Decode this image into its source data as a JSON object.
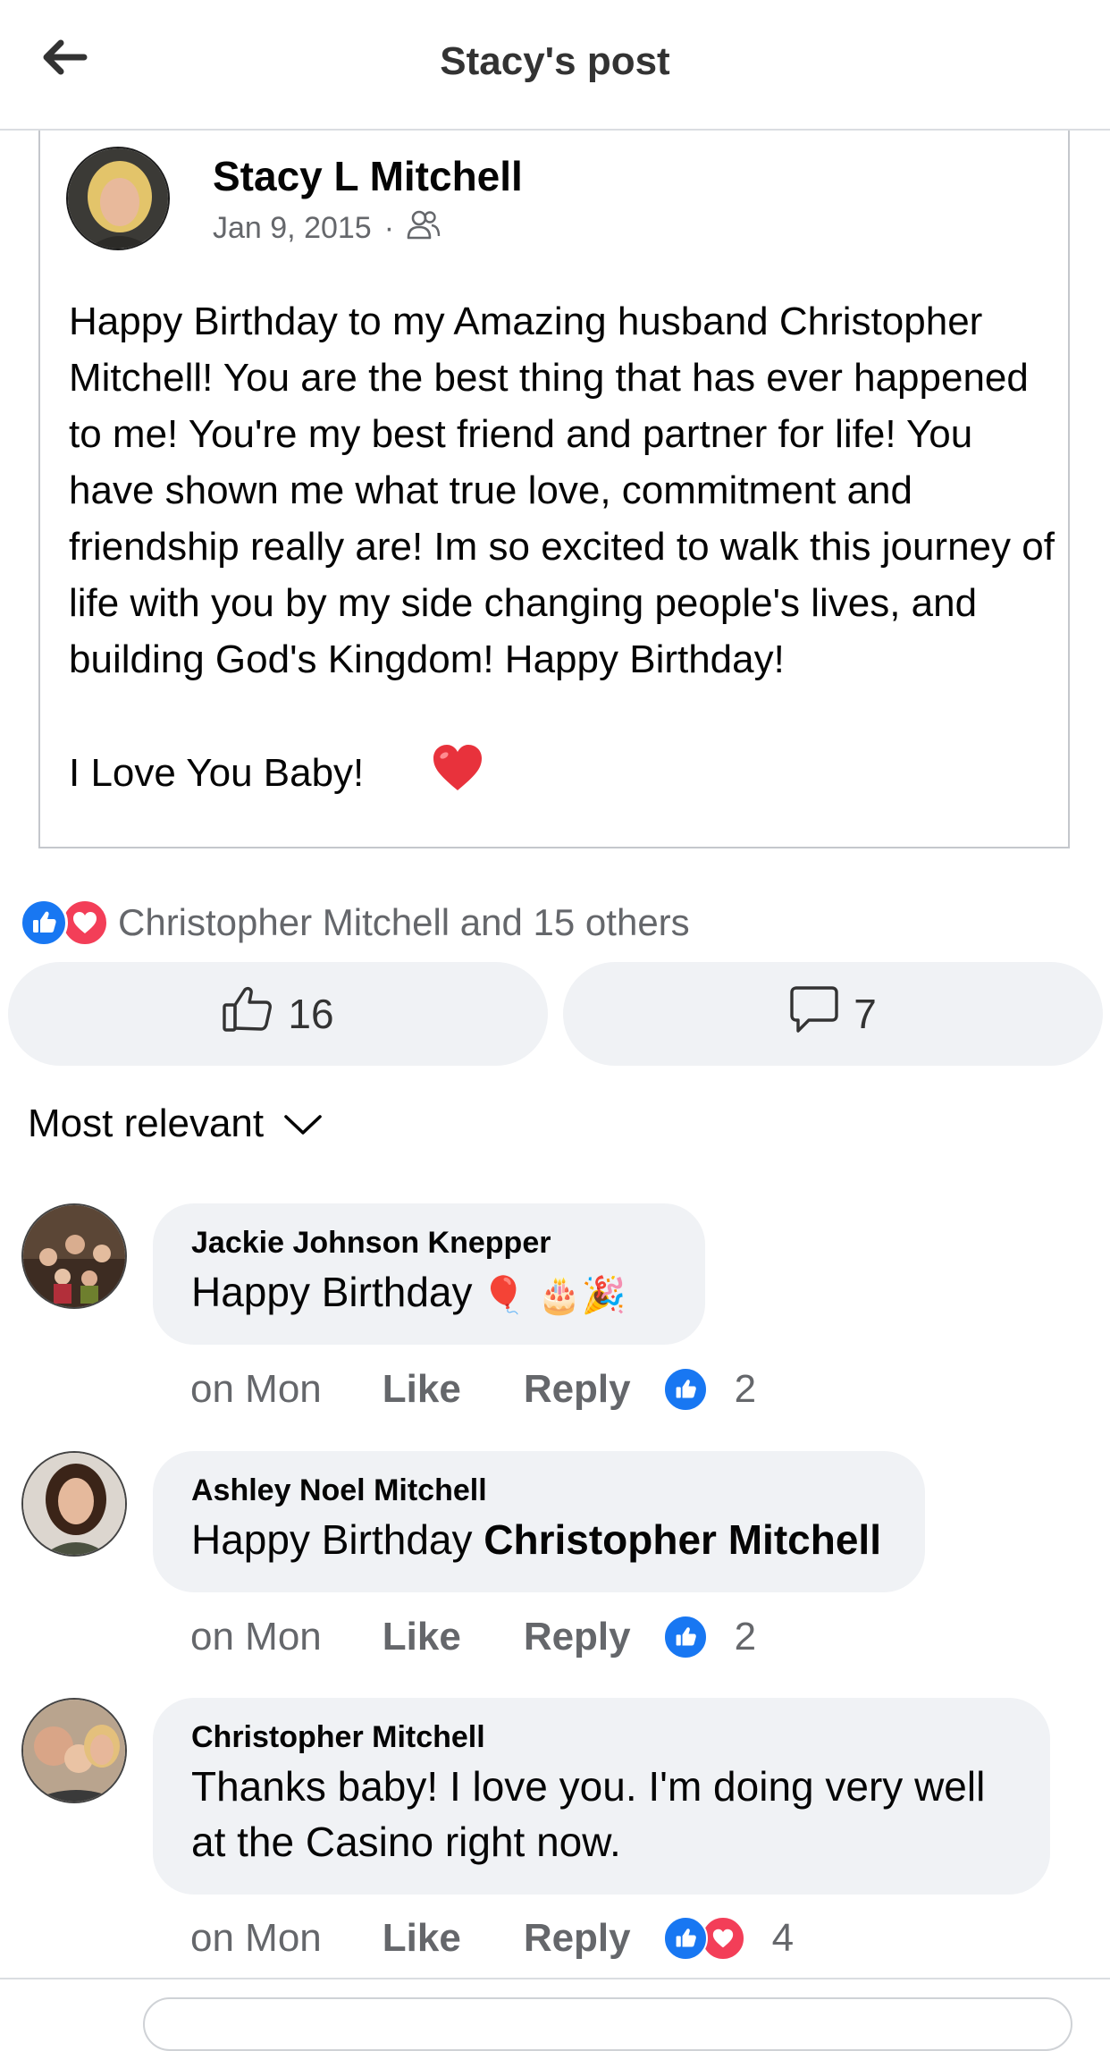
{
  "header": {
    "title": "Stacy's post",
    "back_icon": "arrow-left-icon"
  },
  "post": {
    "author": "Stacy L Mitchell",
    "date": "Jan 9, 2015",
    "separator": "·",
    "audience_icon": "friends-icon",
    "text": "Happy Birthday to my Amazing husband Christopher Mitchell! You are the best thing that has ever happened to me! You're my best friend and partner for life! You have shown me what true love, commitment and friendship really are! Im so excited to walk this journey of life with you by my side changing people's lives, and building God's Kingdom! Happy Birthday!\nI Love You Baby!",
    "trailing_emoji": "❤️"
  },
  "reactions": {
    "summary": "Christopher Mitchell and 15 others",
    "icons": [
      "like-reaction-icon",
      "love-reaction-icon"
    ]
  },
  "actions": {
    "like_count": "16",
    "comment_count": "7"
  },
  "sort": {
    "label": "Most relevant"
  },
  "comments": [
    {
      "name": "Jackie Johnson Knepper",
      "text": "Happy Birthday",
      "emojis": "🎈 🎂🎉",
      "time": "on Mon",
      "like": "Like",
      "reply": "Reply",
      "reaction_count": "2"
    },
    {
      "name": "Ashley Noel Mitchell",
      "text": "Happy Birthday",
      "mention": "Christopher Mitchell",
      "time": "on Mon",
      "like": "Like",
      "reply": "Reply",
      "reaction_count": "2"
    },
    {
      "name": "Christopher Mitchell",
      "text": "Thanks baby! I love you. I'm doing very well at the Casino right now.",
      "time": "on Mon",
      "like": "Like",
      "reply": "Reply",
      "reaction_count": "4"
    }
  ],
  "colors": {
    "like_blue": "#1877f2",
    "love_red": "#f33e58",
    "bubble_bg": "#f0f2f5",
    "secondary_text": "#65676b"
  }
}
